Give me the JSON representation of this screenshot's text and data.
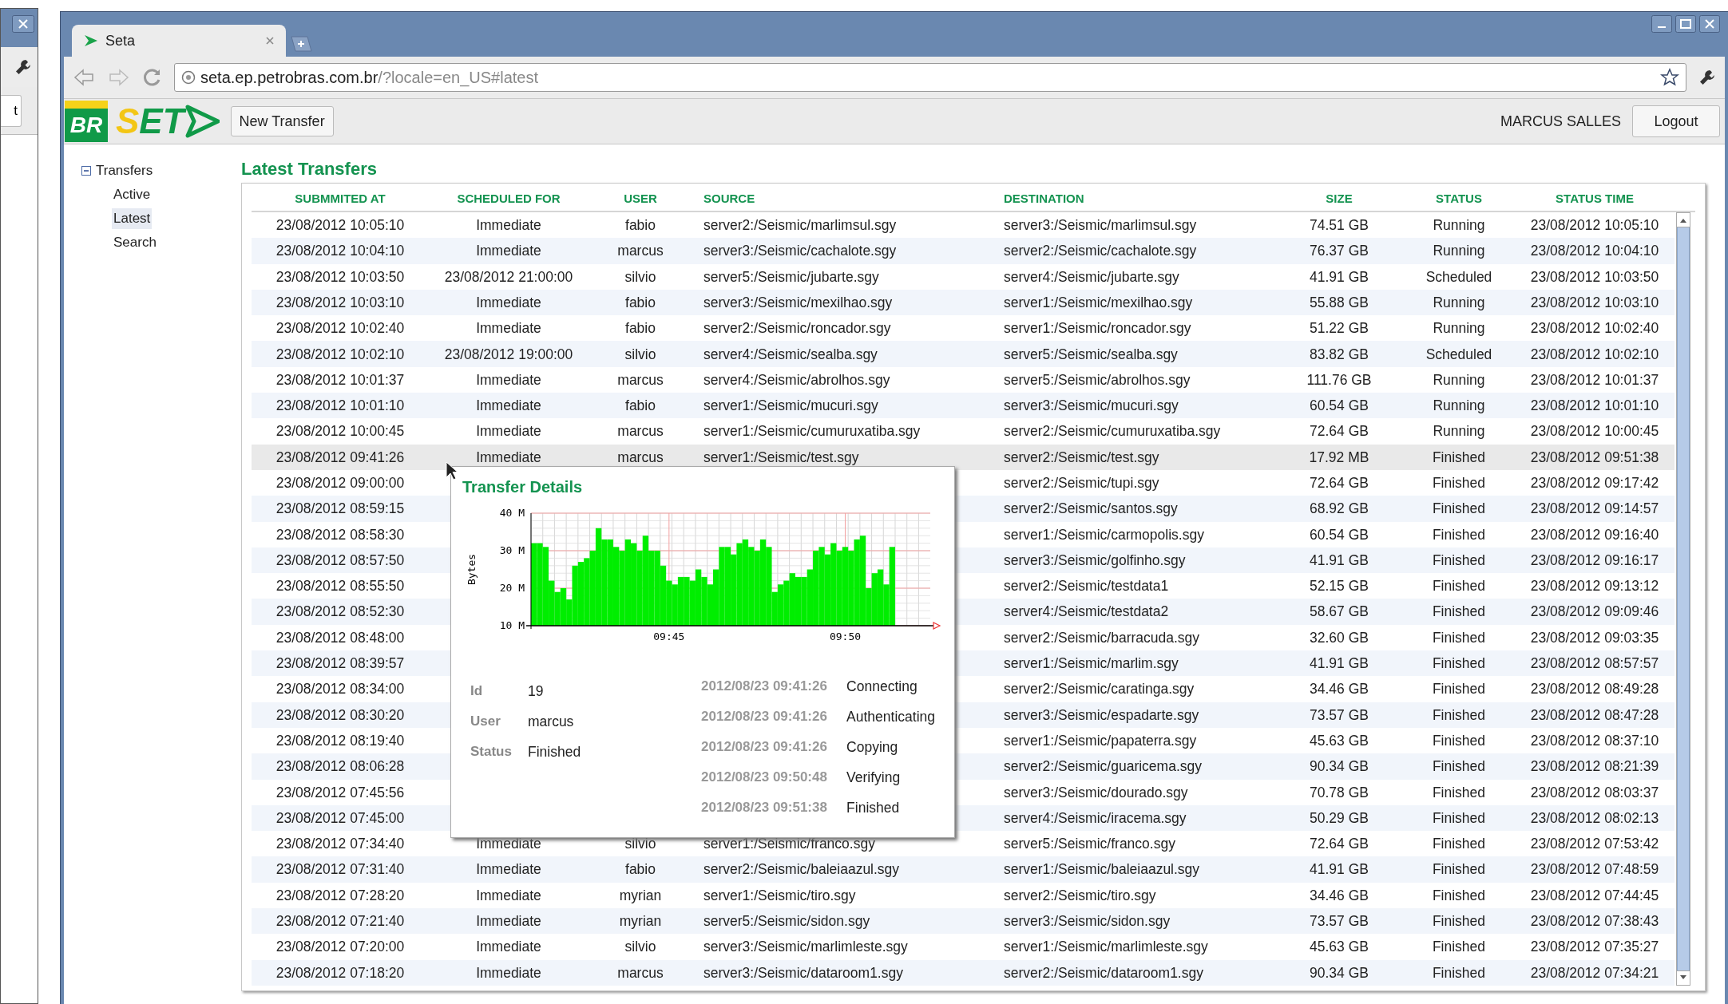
{
  "background_window": {
    "button": "t"
  },
  "browser": {
    "tab": {
      "title": "Seta",
      "selected": true
    },
    "url": {
      "host": "seta.ep.petrobras.com.br",
      "path": "/?locale=en_US#latest"
    }
  },
  "header": {
    "logo_badge": "BR",
    "logo_text": "SET",
    "new_button": "New Transfer",
    "user_name": "MARCUS SALLES",
    "logout_button": "Logout"
  },
  "sidebar": {
    "items": [
      {
        "label": "Transfers",
        "expanded": true,
        "children": [
          {
            "label": "Active",
            "selected": false
          },
          {
            "label": "Latest",
            "selected": true
          },
          {
            "label": "Search",
            "selected": false
          }
        ]
      }
    ]
  },
  "title": "Latest Transfers",
  "table": {
    "columns": [
      "SUBMMITED AT",
      "SCHEDULED FOR",
      "USER",
      "SOURCE",
      "DESTINATION",
      "SIZE",
      "STATUS",
      "STATUS TIME"
    ],
    "rows": [
      {
        "submitted_at": "23/08/2012 10:05:10",
        "scheduled_for": "Immediate",
        "user": "fabio",
        "source": "server2:/Seismic/marlimsul.sgy",
        "destination": "server3:/Seismic/marlimsul.sgy",
        "size": "74.51 GB",
        "status": "Running",
        "status_time": "23/08/2012 10:05:10",
        "selected": false
      },
      {
        "submitted_at": "23/08/2012 10:04:10",
        "scheduled_for": "Immediate",
        "user": "marcus",
        "source": "server3:/Seismic/cachalote.sgy",
        "destination": "server2:/Seismic/cachalote.sgy",
        "size": "76.37 GB",
        "status": "Running",
        "status_time": "23/08/2012 10:04:10",
        "selected": false
      },
      {
        "submitted_at": "23/08/2012 10:03:50",
        "scheduled_for": "23/08/2012 21:00:00",
        "user": "silvio",
        "source": "server5:/Seismic/jubarte.sgy",
        "destination": "server4:/Seismic/jubarte.sgy",
        "size": "41.91 GB",
        "status": "Scheduled",
        "status_time": "23/08/2012 10:03:50",
        "selected": false
      },
      {
        "submitted_at": "23/08/2012 10:03:10",
        "scheduled_for": "Immediate",
        "user": "fabio",
        "source": "server3:/Seismic/mexilhao.sgy",
        "destination": "server1:/Seismic/mexilhao.sgy",
        "size": "55.88 GB",
        "status": "Running",
        "status_time": "23/08/2012 10:03:10",
        "selected": false
      },
      {
        "submitted_at": "23/08/2012 10:02:40",
        "scheduled_for": "Immediate",
        "user": "fabio",
        "source": "server2:/Seismic/roncador.sgy",
        "destination": "server1:/Seismic/roncador.sgy",
        "size": "51.22 GB",
        "status": "Running",
        "status_time": "23/08/2012 10:02:40",
        "selected": false
      },
      {
        "submitted_at": "23/08/2012 10:02:10",
        "scheduled_for": "23/08/2012 19:00:00",
        "user": "silvio",
        "source": "server4:/Seismic/sealba.sgy",
        "destination": "server5:/Seismic/sealba.sgy",
        "size": "83.82 GB",
        "status": "Scheduled",
        "status_time": "23/08/2012 10:02:10",
        "selected": false
      },
      {
        "submitted_at": "23/08/2012 10:01:37",
        "scheduled_for": "Immediate",
        "user": "marcus",
        "source": "server4:/Seismic/abrolhos.sgy",
        "destination": "server5:/Seismic/abrolhos.sgy",
        "size": "111.76 GB",
        "status": "Running",
        "status_time": "23/08/2012 10:01:37",
        "selected": false
      },
      {
        "submitted_at": "23/08/2012 10:01:10",
        "scheduled_for": "Immediate",
        "user": "fabio",
        "source": "server1:/Seismic/mucuri.sgy",
        "destination": "server3:/Seismic/mucuri.sgy",
        "size": "60.54 GB",
        "status": "Running",
        "status_time": "23/08/2012 10:01:10",
        "selected": false
      },
      {
        "submitted_at": "23/08/2012 10:00:45",
        "scheduled_for": "Immediate",
        "user": "marcus",
        "source": "server1:/Seismic/cumuruxatiba.sgy",
        "destination": "server2:/Seismic/cumuruxatiba.sgy",
        "size": "72.64 GB",
        "status": "Running",
        "status_time": "23/08/2012 10:00:45",
        "selected": false
      },
      {
        "submitted_at": "23/08/2012 09:41:26",
        "scheduled_for": "Immediate",
        "user": "marcus",
        "source": "server1:/Seismic/test.sgy",
        "destination": "server2:/Seismic/test.sgy",
        "size": "17.92 MB",
        "status": "Finished",
        "status_time": "23/08/2012 09:51:38",
        "selected": true
      },
      {
        "submitted_at": "23/08/2012 09:00:00",
        "destination": "server2:/Seismic/tupi.sgy",
        "size": "72.64 GB",
        "status": "Finished",
        "status_time": "23/08/2012 09:17:42",
        "selected": false
      },
      {
        "submitted_at": "23/08/2012 08:59:15",
        "destination": "server2:/Seismic/santos.sgy",
        "size": "68.92 GB",
        "status": "Finished",
        "status_time": "23/08/2012 09:14:57",
        "selected": false
      },
      {
        "submitted_at": "23/08/2012 08:58:30",
        "destination": "server1:/Seismic/carmopolis.sgy",
        "size": "60.54 GB",
        "status": "Finished",
        "status_time": "23/08/2012 09:16:40",
        "selected": false
      },
      {
        "submitted_at": "23/08/2012 08:57:50",
        "destination": "server3:/Seismic/golfinho.sgy",
        "size": "41.91 GB",
        "status": "Finished",
        "status_time": "23/08/2012 09:16:17",
        "selected": false
      },
      {
        "submitted_at": "23/08/2012 08:55:50",
        "destination": "server2:/Seismic/testdata1",
        "size": "52.15 GB",
        "status": "Finished",
        "status_time": "23/08/2012 09:13:12",
        "selected": false
      },
      {
        "submitted_at": "23/08/2012 08:52:30",
        "destination": "server4:/Seismic/testdata2",
        "size": "58.67 GB",
        "status": "Finished",
        "status_time": "23/08/2012 09:09:46",
        "selected": false
      },
      {
        "submitted_at": "23/08/2012 08:48:00",
        "destination": "server2:/Seismic/barracuda.sgy",
        "size": "32.60 GB",
        "status": "Finished",
        "status_time": "23/08/2012 09:03:35",
        "selected": false
      },
      {
        "submitted_at": "23/08/2012 08:39:57",
        "destination": "server1:/Seismic/marlim.sgy",
        "size": "41.91 GB",
        "status": "Finished",
        "status_time": "23/08/2012 08:57:57",
        "selected": false
      },
      {
        "submitted_at": "23/08/2012 08:34:00",
        "destination": "server2:/Seismic/caratinga.sgy",
        "size": "34.46 GB",
        "status": "Finished",
        "status_time": "23/08/2012 08:49:28",
        "selected": false
      },
      {
        "submitted_at": "23/08/2012 08:30:20",
        "destination": "server3:/Seismic/espadarte.sgy",
        "size": "73.57 GB",
        "status": "Finished",
        "status_time": "23/08/2012 08:47:28",
        "selected": false
      },
      {
        "submitted_at": "23/08/2012 08:19:40",
        "destination": "server1:/Seismic/papaterra.sgy",
        "size": "45.63 GB",
        "status": "Finished",
        "status_time": "23/08/2012 08:37:10",
        "selected": false
      },
      {
        "submitted_at": "23/08/2012 08:06:28",
        "destination": "server2:/Seismic/guaricema.sgy",
        "size": "90.34 GB",
        "status": "Finished",
        "status_time": "23/08/2012 08:21:39",
        "selected": false
      },
      {
        "submitted_at": "23/08/2012 07:45:56",
        "destination": "server3:/Seismic/dourado.sgy",
        "size": "70.78 GB",
        "status": "Finished",
        "status_time": "23/08/2012 08:03:37",
        "selected": false
      },
      {
        "submitted_at": "23/08/2012 07:45:00",
        "destination": "server4:/Seismic/iracema.sgy",
        "size": "50.29 GB",
        "status": "Finished",
        "status_time": "23/08/2012 08:02:13",
        "selected": false
      },
      {
        "submitted_at": "23/08/2012 07:34:40",
        "scheduled_for": "Immediate",
        "user": "silvio",
        "source": "server1:/Seismic/franco.sgy",
        "destination": "server5:/Seismic/franco.sgy",
        "size": "72.64 GB",
        "status": "Finished",
        "status_time": "23/08/2012 07:53:42",
        "selected": false
      },
      {
        "submitted_at": "23/08/2012 07:31:40",
        "scheduled_for": "Immediate",
        "user": "fabio",
        "source": "server2:/Seismic/baleiaazul.sgy",
        "destination": "server1:/Seismic/baleiaazul.sgy",
        "size": "41.91 GB",
        "status": "Finished",
        "status_time": "23/08/2012 07:48:59",
        "selected": false
      },
      {
        "submitted_at": "23/08/2012 07:28:20",
        "scheduled_for": "Immediate",
        "user": "myrian",
        "source": "server1:/Seismic/tiro.sgy",
        "destination": "server2:/Seismic/tiro.sgy",
        "size": "34.46 GB",
        "status": "Finished",
        "status_time": "23/08/2012 07:44:45",
        "selected": false
      },
      {
        "submitted_at": "23/08/2012 07:21:40",
        "scheduled_for": "Immediate",
        "user": "myrian",
        "source": "server5:/Seismic/sidon.sgy",
        "destination": "server3:/Seismic/sidon.sgy",
        "size": "73.57 GB",
        "status": "Finished",
        "status_time": "23/08/2012 07:38:43",
        "selected": false
      },
      {
        "submitted_at": "23/08/2012 07:20:00",
        "scheduled_for": "Immediate",
        "user": "silvio",
        "source": "server3:/Seismic/marlimleste.sgy",
        "destination": "server1:/Seismic/marlimleste.sgy",
        "size": "45.63 GB",
        "status": "Finished",
        "status_time": "23/08/2012 07:35:27",
        "selected": false
      },
      {
        "submitted_at": "23/08/2012 07:18:20",
        "scheduled_for": "Immediate",
        "user": "marcus",
        "source": "server3:/Seismic/dataroom1.sgy",
        "destination": "server2:/Seismic/dataroom1.sgy",
        "size": "90.34 GB",
        "status": "Finished",
        "status_time": "23/08/2012 07:34:21",
        "selected": false
      }
    ]
  },
  "details_popup": {
    "title": "Transfer Details",
    "chart_data": {
      "type": "bar",
      "ylabel": "Bytes",
      "ylim": [
        10,
        40
      ],
      "grid": true,
      "categories": [
        null,
        null,
        null,
        null,
        null,
        null,
        null,
        null,
        null,
        null,
        null,
        null,
        null,
        null,
        null,
        null,
        null,
        null,
        null,
        null,
        null,
        null,
        null,
        "09:45",
        null,
        null,
        null,
        null,
        null,
        null,
        null,
        null,
        null,
        null,
        null,
        null,
        null,
        null,
        null,
        null,
        null,
        null,
        null,
        null,
        null,
        null,
        null,
        null,
        null,
        null,
        null,
        null,
        null,
        "09:50",
        null,
        null,
        null,
        null,
        null,
        null,
        null,
        null
      ],
      "yticks": [
        {
          "value": 10,
          "label": "10 M"
        },
        {
          "value": 20,
          "label": "20 M"
        },
        {
          "value": 30,
          "label": "30 M"
        },
        {
          "value": 40,
          "label": "40 M"
        }
      ],
      "series": [
        {
          "color": "#00ee00",
          "values": [
            32,
            32,
            31,
            22,
            19,
            20,
            17,
            26,
            27,
            28,
            30,
            36,
            33,
            33,
            31,
            30,
            33,
            32,
            30,
            34,
            30,
            30,
            26,
            22,
            21,
            23,
            23,
            22,
            25,
            23,
            21,
            25,
            31,
            31,
            29,
            32,
            33,
            31,
            30,
            33,
            31,
            19,
            21,
            22,
            24,
            23,
            23,
            25,
            30,
            31,
            29,
            32,
            30,
            31,
            30,
            33,
            34,
            20,
            24,
            25,
            21,
            31
          ]
        }
      ]
    },
    "fields": [
      {
        "label": "Id",
        "value": "19"
      },
      {
        "label": "User",
        "value": "marcus"
      },
      {
        "label": "Status",
        "value": "Finished"
      }
    ],
    "log": [
      {
        "time": "2012/08/23 09:41:26",
        "event": "Connecting"
      },
      {
        "time": "2012/08/23 09:41:26",
        "event": "Authenticating"
      },
      {
        "time": "2012/08/23 09:41:26",
        "event": "Copying"
      },
      {
        "time": "2012/08/23 09:50:48",
        "event": "Verifying"
      },
      {
        "time": "2012/08/23 09:51:38",
        "event": "Finished"
      }
    ]
  }
}
